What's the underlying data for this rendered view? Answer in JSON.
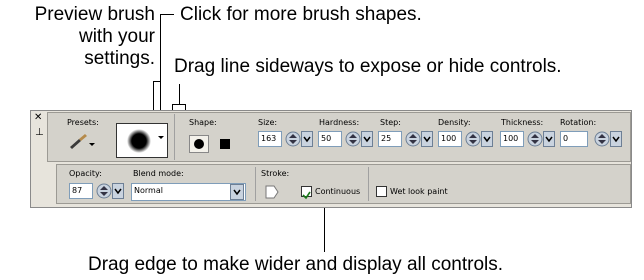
{
  "callouts": {
    "preview_brush": [
      "Preview brush",
      "with your",
      "settings."
    ],
    "click_shapes": "Click for more brush shapes.",
    "drag_sideways": "Drag line sideways to expose or hide controls.",
    "drag_edge": "Drag edge to make wider and display all controls."
  },
  "toolbar": {
    "presets_label": "Presets:",
    "shape_label": "Shape:",
    "size_label": "Size:",
    "size_value": "163",
    "hardness_label": "Hardness:",
    "hardness_value": "50",
    "step_label": "Step:",
    "step_value": "25",
    "density_label": "Density:",
    "density_value": "100",
    "thickness_label": "Thickness:",
    "thickness_value": "100",
    "rotation_label": "Rotation:",
    "rotation_value": "0",
    "opacity_label": "Opacity:",
    "opacity_value": "87",
    "blend_label": "Blend mode:",
    "blend_value": "Normal",
    "stroke_label": "Stroke:",
    "continuous_label": "Continuous",
    "continuous_checked": true,
    "wetlook_label": "Wet look paint",
    "wetlook_checked": false
  },
  "colors": {
    "toolbar_bg": "#e7e4dc",
    "field_border": "#7f9db9"
  }
}
